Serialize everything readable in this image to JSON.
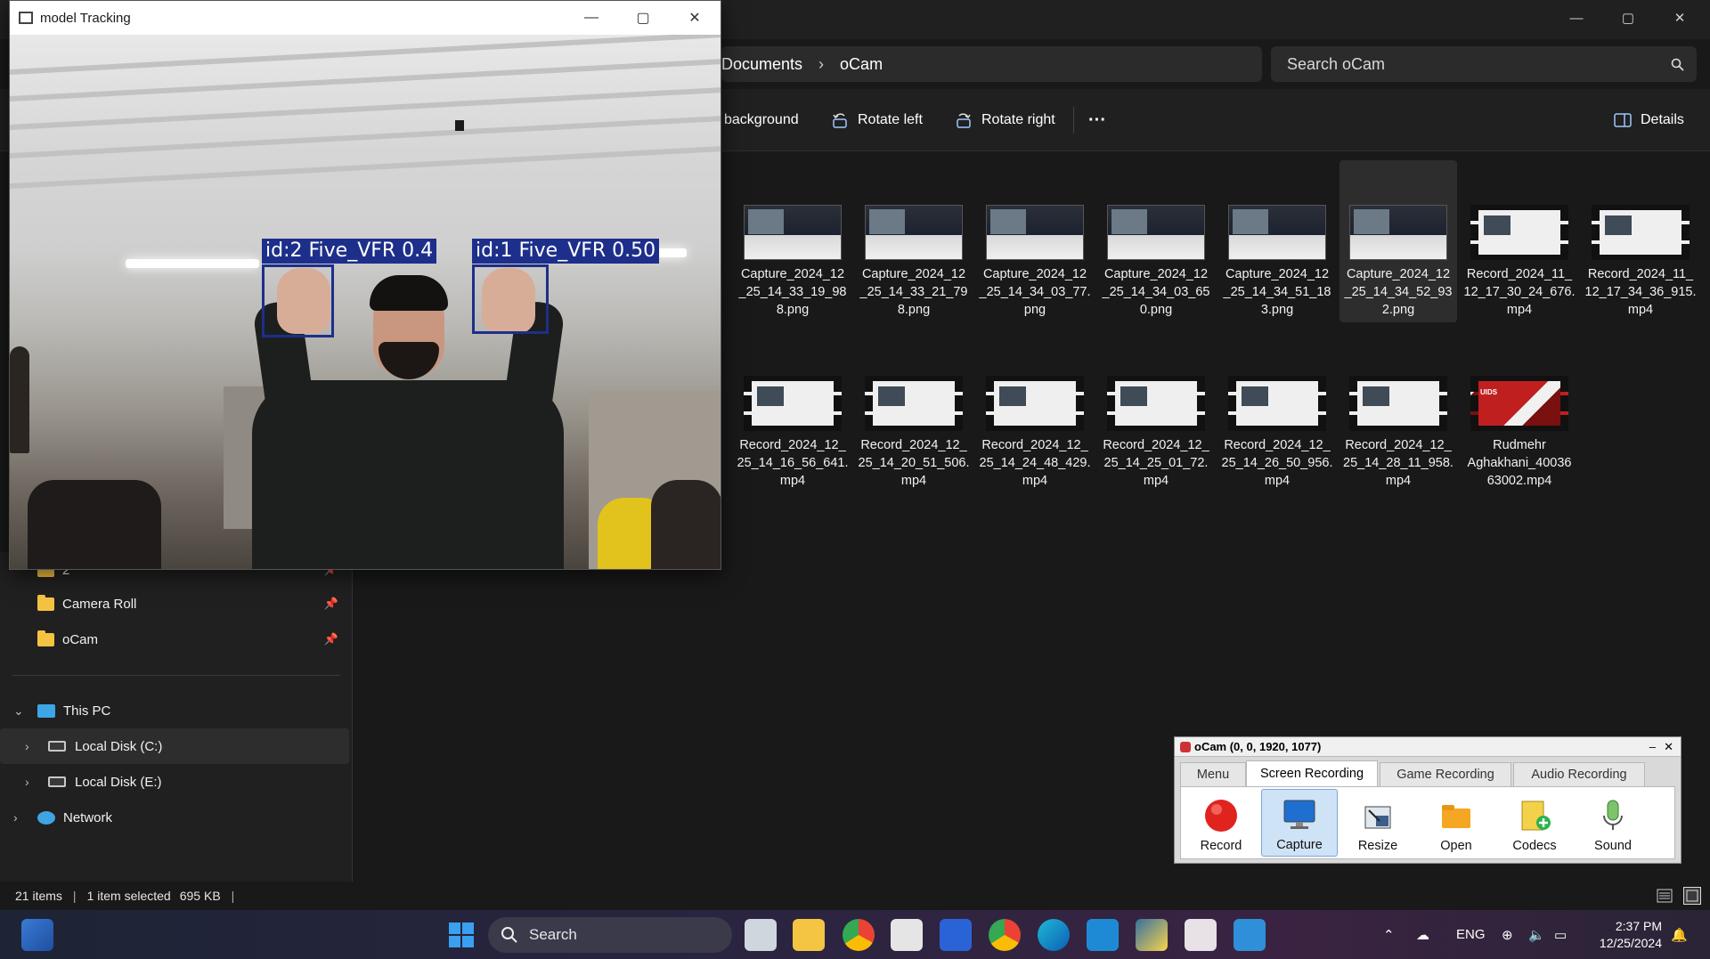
{
  "explorer": {
    "window_controls": {
      "minimize": "—",
      "maximize": "▢",
      "close": "✕"
    },
    "breadcrumb": [
      "Documents",
      "oCam"
    ],
    "breadcrumb_separator": "›",
    "search_placeholder": "Search oCam",
    "commands": {
      "set_background": "background",
      "rotate_left": "Rotate left",
      "rotate_right": "Rotate right",
      "more": "···",
      "details": "Details"
    },
    "files": [
      {
        "name": "Capture_2024_12_25_14_33_19_988.png",
        "lines": [
          "Capture_2024_12",
          "_25_14_33_19_98",
          "8.png"
        ],
        "kind": "img",
        "selected": false
      },
      {
        "name": "Capture_2024_12_25_14_33_21_798.png",
        "lines": [
          "Capture_2024_12",
          "_25_14_33_21_79",
          "8.png"
        ],
        "kind": "img",
        "selected": false
      },
      {
        "name": "Capture_2024_12_25_14_34_03_77.png",
        "lines": [
          "Capture_2024_12",
          "_25_14_34_03_77.",
          "png"
        ],
        "kind": "img",
        "selected": false
      },
      {
        "name": "Capture_2024_12_25_14_34_03_650.png",
        "lines": [
          "Capture_2024_12",
          "_25_14_34_03_65",
          "0.png"
        ],
        "kind": "img",
        "selected": false
      },
      {
        "name": "Capture_2024_12_25_14_34_51_183.png",
        "lines": [
          "Capture_2024_12",
          "_25_14_34_51_18",
          "3.png"
        ],
        "kind": "img",
        "selected": false
      },
      {
        "name": "Capture_2024_12_25_14_34_52_932.png",
        "lines": [
          "Capture_2024_12",
          "_25_14_34_52_93",
          "2.png"
        ],
        "kind": "img",
        "selected": true
      },
      {
        "name": "Record_2024_11_12_17_30_24_676.mp4",
        "lines": [
          "Record_2024_11_",
          "12_17_30_24_676.",
          "mp4"
        ],
        "kind": "vid",
        "selected": false
      },
      {
        "name": "Record_2024_11_12_17_34_36_915.mp4",
        "lines": [
          "Record_2024_11_",
          "12_17_34_36_915.",
          "mp4"
        ],
        "kind": "vid",
        "selected": false
      },
      {
        "name": "Record_2024_12_25_14_16_56_641.mp4",
        "lines": [
          "Record_2024_12_",
          "25_14_16_56_641.",
          "mp4"
        ],
        "kind": "vid",
        "selected": false
      },
      {
        "name": "Record_2024_12_25_14_20_51_506.mp4",
        "lines": [
          "Record_2024_12_",
          "25_14_20_51_506.",
          "mp4"
        ],
        "kind": "vid",
        "selected": false
      },
      {
        "name": "Record_2024_12_25_14_24_48_429.mp4",
        "lines": [
          "Record_2024_12_",
          "25_14_24_48_429.",
          "mp4"
        ],
        "kind": "vid",
        "selected": false
      },
      {
        "name": "Record_2024_12_25_14_25_01_72.mp4",
        "lines": [
          "Record_2024_12_",
          "25_14_25_01_72.",
          "mp4"
        ],
        "kind": "vid",
        "selected": false
      },
      {
        "name": "Record_2024_12_25_14_26_50_956.mp4",
        "lines": [
          "Record_2024_12_",
          "25_14_26_50_956.",
          "mp4"
        ],
        "kind": "vid",
        "selected": false
      },
      {
        "name": "Record_2024_12_25_14_28_11_958.mp4",
        "lines": [
          "Record_2024_12_",
          "25_14_28_11_958.",
          "mp4"
        ],
        "kind": "vid",
        "selected": false
      },
      {
        "name": "Rudmehr Aghakhani_4003663002.mp4",
        "lines": [
          "Rudmehr",
          "Aghakhani_40036",
          "63002.mp4"
        ],
        "kind": "red",
        "thumb_text": "UIDS",
        "selected": false
      }
    ],
    "sidebar": {
      "quick_access": [
        {
          "label": "2",
          "pinned": true
        },
        {
          "label": "Camera Roll",
          "pinned": true
        },
        {
          "label": "oCam",
          "pinned": true
        }
      ],
      "this_pc": "This PC",
      "drives": [
        {
          "label": "Local Disk (C:)",
          "selected": true
        },
        {
          "label": "Local Disk (E:)",
          "selected": false
        }
      ],
      "network": "Network"
    },
    "status": {
      "item_count": "21 items",
      "selection": "1 item selected",
      "size": "695 KB"
    }
  },
  "tracking_window": {
    "title": "model Tracking",
    "window_controls": {
      "minimize": "—",
      "maximize": "▢",
      "close": "✕"
    },
    "detections": [
      {
        "label": "id:2 Five_VFR 0.4"
      },
      {
        "label": "id:1 Five_VFR 0.50"
      }
    ]
  },
  "ocam": {
    "title": "oCam (0, 0, 1920, 1077)",
    "controls": {
      "minimize": "–",
      "close": "✕"
    },
    "tabs": [
      {
        "label": "Menu",
        "active": false
      },
      {
        "label": "Screen Recording",
        "active": true
      },
      {
        "label": "Game Recording",
        "active": false
      },
      {
        "label": "Audio Recording",
        "active": false
      }
    ],
    "buttons": [
      {
        "label": "Record",
        "icon": "record-icon"
      },
      {
        "label": "Capture",
        "icon": "monitor-icon",
        "selected": true
      },
      {
        "label": "Resize",
        "icon": "resize-icon"
      },
      {
        "label": "Open",
        "icon": "folder-icon"
      },
      {
        "label": "Codecs",
        "icon": "codecs-icon"
      },
      {
        "label": "Sound",
        "icon": "microphone-icon"
      }
    ]
  },
  "taskbar": {
    "search_label": "Search",
    "apps": [
      "task-view-icon",
      "file-explorer-icon",
      "chrome-icon",
      "snipping-tool-icon",
      "todo-icon",
      "chrome-profile-icon",
      "edge-icon",
      "vscode-icon",
      "python-icon",
      "ocam-icon",
      "photos-icon"
    ],
    "tray": {
      "language": "ENG",
      "time": "2:37 PM",
      "date": "12/25/2024"
    }
  },
  "colors": {
    "accent": "#1d2f8a",
    "explorer_bg": "#191919",
    "selection": "#2d2d2d"
  }
}
